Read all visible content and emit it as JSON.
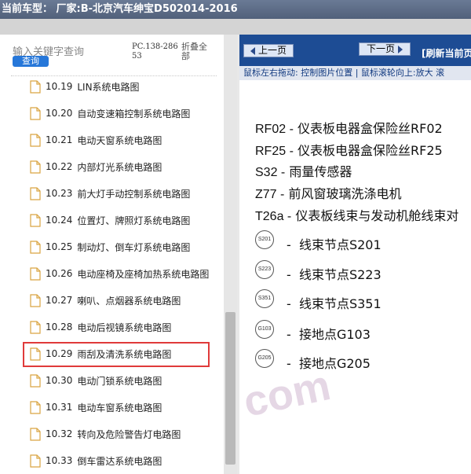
{
  "window": {
    "title": "当前车型：  厂家:B-北京汽车绅宝D502014-2016"
  },
  "left_panel": {
    "search_label": "输入关键字查询",
    "search_button": "查询",
    "pc_code": "PC.138-28653",
    "collapse_all": "折叠全部",
    "items": [
      {
        "num": "10.19",
        "title": "LIN系统电路图"
      },
      {
        "num": "10.20",
        "title": "自动变速箱控制系统电路图"
      },
      {
        "num": "10.21",
        "title": "电动天窗系统电路图"
      },
      {
        "num": "10.22",
        "title": "内部灯光系统电路图"
      },
      {
        "num": "10.23",
        "title": "前大灯手动控制系统电路图"
      },
      {
        "num": "10.24",
        "title": "位置灯、牌照灯系统电路图"
      },
      {
        "num": "10.25",
        "title": "制动灯、倒车灯系统电路图"
      },
      {
        "num": "10.26",
        "title": "电动座椅及座椅加热系统电路图"
      },
      {
        "num": "10.27",
        "title": "喇叭、点烟器系统电路图"
      },
      {
        "num": "10.28",
        "title": "电动后视镜系统电路图"
      },
      {
        "num": "10.29",
        "title": "雨刮及清洗系统电路图"
      },
      {
        "num": "10.30",
        "title": "电动门锁系统电路图"
      },
      {
        "num": "10.31",
        "title": "电动车窗系统电路图"
      },
      {
        "num": "10.32",
        "title": "转向及危险警告灯电路图"
      },
      {
        "num": "10.33",
        "title": "倒车雷达系统电路图"
      }
    ]
  },
  "right_panel": {
    "prev_button": "上一页",
    "next_button": "下一页",
    "refresh": "[刷新当前页",
    "hint": "鼠标左右拖动: 控制图片位置 | 鼠标滚轮向上:放大  滚",
    "legend": [
      {
        "code": "RF02 -",
        "text": "仪表板电器盒保险丝RF02"
      },
      {
        "code": "RF25 -",
        "text": "仪表板电器盒保险丝RF25"
      },
      {
        "code": "S32 -",
        "text": "雨量传感器"
      },
      {
        "code": "Z77 -",
        "text": "前风窗玻璃洗涤电机"
      },
      {
        "code": "T26a -",
        "text": "仪表板线束与发动机舱线束对"
      }
    ],
    "nodes": [
      {
        "icon": "S201",
        "text": "线束节点S201"
      },
      {
        "icon": "S223",
        "text": "线束节点S223"
      },
      {
        "icon": "S351",
        "text": "线束节点S351"
      },
      {
        "icon": "G103",
        "text": "接地点G103"
      },
      {
        "icon": "G205",
        "text": "接地点G205"
      }
    ],
    "node_dash": "-"
  },
  "watermark": "com",
  "colors": {
    "nav_bar": "#1d4c94",
    "highlight": "#e03a3a",
    "search_button": "#2677d9"
  }
}
